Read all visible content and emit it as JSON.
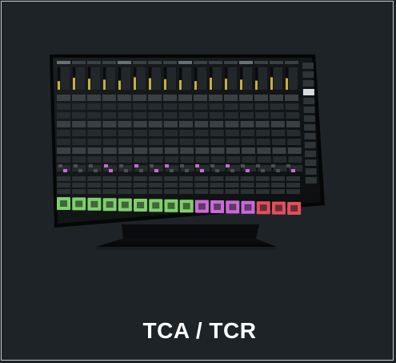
{
  "card": {
    "caption": "TCA / TCR"
  },
  "image": {
    "subject": "touchscreen-mixing-console-on-stand",
    "colors": {
      "background": "#1d2327",
      "border": "#c9ccce",
      "screen_dark": "#101314",
      "green_strip": "#7fd06a",
      "purple_strip": "#c86bd6",
      "red_strip": "#e0505e",
      "meter_yellow": "#c8b03a",
      "caption_text": "#ffffff"
    }
  }
}
